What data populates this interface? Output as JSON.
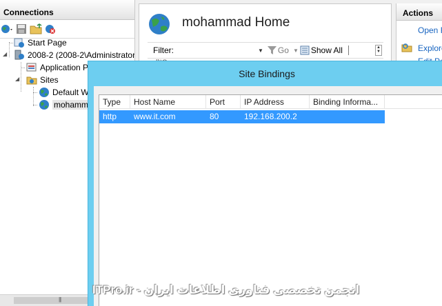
{
  "connections": {
    "title": "Connections",
    "tree": [
      {
        "label": "Start Page"
      },
      {
        "label": "2008-2 (2008-2\\Administrator"
      },
      {
        "label": "Application P"
      },
      {
        "label": "Sites"
      },
      {
        "label": "Default W"
      },
      {
        "label": "mohamm"
      }
    ]
  },
  "center": {
    "title": "mohammad Home",
    "filter": {
      "label": "Filter:",
      "value": "",
      "go_label": "Go",
      "show_all_label": "Show All"
    },
    "hidden_text": "ll*S"
  },
  "actions": {
    "title": "Actions",
    "items": [
      {
        "label": "Open F"
      },
      {
        "label": "Explore"
      },
      {
        "label": "Edit Pe"
      }
    ]
  },
  "dialog": {
    "title": "Site Bindings",
    "columns": [
      "Type",
      "Host Name",
      "Port",
      "IP Address",
      "Binding Informa..."
    ],
    "rows": [
      {
        "type": "http",
        "host": "www.it.com",
        "port": "80",
        "ip": "192.168.200.2",
        "info": ""
      }
    ]
  },
  "watermark": "ITPro.ir - انجمن تخصصی فناوری اطلاعات ایران",
  "colors": {
    "dialog_frame": "#6dcef0",
    "selection": "#3399ff",
    "link": "#1764c0"
  }
}
